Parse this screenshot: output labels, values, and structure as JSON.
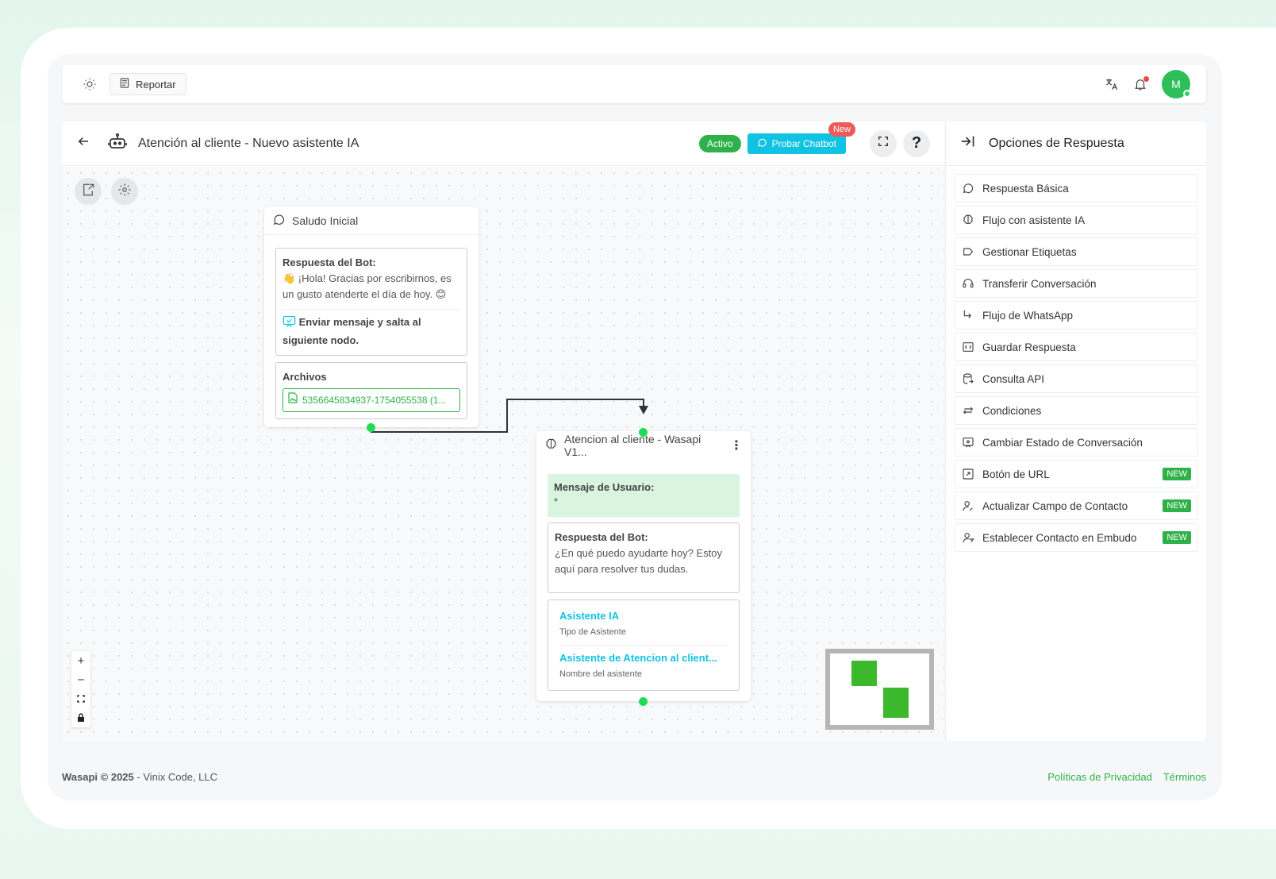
{
  "topbar": {
    "report_label": "Reportar",
    "avatar_initial": "M"
  },
  "editor": {
    "title": "Atención al cliente - Nuevo asistente IA",
    "status_badge": "Activo",
    "test_button": "Probar Chatbot",
    "new_badge": "New",
    "help_label": "?"
  },
  "node1": {
    "title": "Saludo Inicial",
    "bot_label": "Respuesta del Bot:",
    "bot_text": "👋 ¡Hola! Gracias por escribirnos, es un gusto atenderte el día de hoy. 😊",
    "action_text": "Enviar mensaje y salta al siguiente nodo.",
    "files_label": "Archivos",
    "file_name": "5356645834937-1754055538 (1..."
  },
  "node2": {
    "title": "Atencion al cliente - Wasapi V1...",
    "user_label": "Mensaje de Usuario:",
    "user_text": "*",
    "bot_label": "Respuesta del Bot:",
    "bot_text": "¿En qué puedo ayudarte hoy? Estoy aquí para resolver tus dudas.",
    "assistant_type_value": "Asistente IA",
    "assistant_type_label": "Tipo de Asistente",
    "assistant_name_value": "Asistente de Atencion al client...",
    "assistant_name_label": "Nombre del asistente"
  },
  "zoom": {
    "in": "+",
    "out": "−"
  },
  "panel": {
    "title": "Opciones de Respuesta",
    "options": [
      {
        "label": "Respuesta Básica",
        "icon": "chat-bubble-icon",
        "new": ""
      },
      {
        "label": "Flujo con asistente IA",
        "icon": "brain-icon",
        "new": ""
      },
      {
        "label": "Gestionar Etiquetas",
        "icon": "tag-icon",
        "new": ""
      },
      {
        "label": "Transferir Conversación",
        "icon": "headset-icon",
        "new": ""
      },
      {
        "label": "Flujo de WhatsApp",
        "icon": "arrow-turn-icon",
        "new": ""
      },
      {
        "label": "Guardar Respuesta",
        "icon": "variable-icon",
        "new": ""
      },
      {
        "label": "Consulta API",
        "icon": "database-icon",
        "new": ""
      },
      {
        "label": "Condiciones",
        "icon": "swap-icon",
        "new": ""
      },
      {
        "label": "Cambiar Estado de Conversación",
        "icon": "status-chat-icon",
        "new": ""
      },
      {
        "label": "Botón de URL",
        "icon": "link-box-icon",
        "new": "NEW"
      },
      {
        "label": "Actualizar Campo de Contacto",
        "icon": "user-edit-icon",
        "new": "NEW"
      },
      {
        "label": "Establecer Contacto en Embudo",
        "icon": "user-funnel-icon",
        "new": "NEW"
      }
    ]
  },
  "footer": {
    "brand": "Wasapi © 2025",
    "company": " - Vinix Code, LLC",
    "privacy": "Políticas de Privacidad",
    "terms": "Términos"
  },
  "colors": {
    "brand_green": "#2fb14a",
    "accent_cyan": "#11c3e3",
    "new_red": "#ee5a5a"
  }
}
